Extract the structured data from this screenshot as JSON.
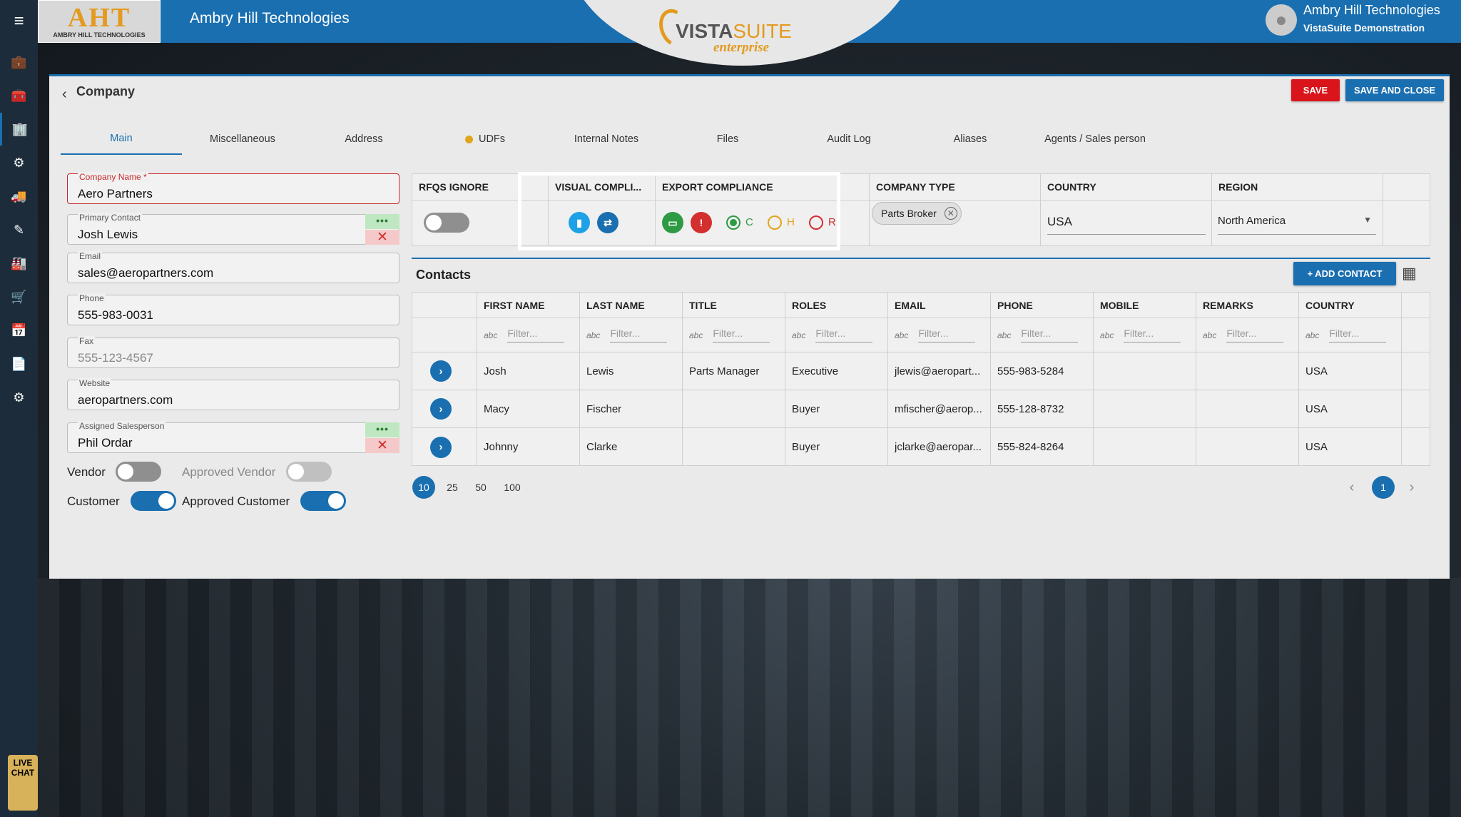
{
  "header": {
    "logo_text": "AHT",
    "logo_subtext": "AMBRY HILL TECHNOLOGIES",
    "app_title": "Ambry Hill Technologies",
    "brand_main": "VISTA",
    "brand_suite": "SUITE",
    "brand_sub": "enterprise",
    "user_name": "Ambry Hill Technologies",
    "user_org": "VistaSuite Demonstration"
  },
  "sidebar": {
    "icons": [
      "menu-icon",
      "briefcase-icon",
      "toolbox-icon",
      "building-icon",
      "parts-icon",
      "truck-icon",
      "edit-icon",
      "warehouse-icon",
      "cart-icon",
      "calendar-icon",
      "document-icon",
      "gear-icon"
    ],
    "live_chat": "LIVE CHAT"
  },
  "page": {
    "title": "Company",
    "save_label": "SAVE",
    "save_close_label": "SAVE AND CLOSE"
  },
  "tabs": [
    "Main",
    "Miscellaneous",
    "Address",
    "UDFs",
    "Internal Notes",
    "Files",
    "Audit Log",
    "Aliases",
    "Agents / Sales person"
  ],
  "form": {
    "company_name_label": "Company Name *",
    "company_name": "Aero Partners",
    "primary_contact_label": "Primary Contact",
    "primary_contact": "Josh Lewis",
    "email_label": "Email",
    "email": "sales@aeropartners.com",
    "phone_label": "Phone",
    "phone": "555-983-0031",
    "fax_label": "Fax",
    "fax": "555-123-4567",
    "website_label": "Website",
    "website": "aeropartners.com",
    "salesperson_label": "Assigned Salesperson",
    "salesperson": "Phil Ordar",
    "vendor_label": "Vendor",
    "approved_vendor_label": "Approved Vendor",
    "customer_label": "Customer",
    "approved_customer_label": "Approved Customer",
    "vendor_on": false,
    "approved_vendor_on": false,
    "customer_on": true,
    "approved_customer_on": true,
    "dots": "•••",
    "x": "✕"
  },
  "compliance": {
    "headers": [
      "RFQS IGNORE",
      "VISUAL COMPLI...",
      "EXPORT COMPLIANCE",
      "COMPANY TYPE",
      "COUNTRY",
      "REGION"
    ],
    "rfqs_ignore_on": false,
    "radio_c": "C",
    "radio_h": "H",
    "radio_r": "R",
    "selected_radio": "C",
    "company_type": "Parts Broker",
    "country": "USA",
    "region": "North America",
    "colors": {
      "green": "#2e9a44",
      "orange": "#e2a41b",
      "red": "#d32f2f",
      "cyan": "#1ea1e6"
    }
  },
  "contacts": {
    "title": "Contacts",
    "add_label": "+ ADD CONTACT",
    "columns": [
      "FIRST NAME",
      "LAST NAME",
      "TITLE",
      "ROLES",
      "EMAIL",
      "PHONE",
      "MOBILE",
      "REMARKS",
      "COUNTRY"
    ],
    "filter_placeholder": "Filter...",
    "rows": [
      [
        "Josh",
        "Lewis",
        "Parts Manager",
        "Executive",
        "jlewis@aeropart...",
        "555-983-5284",
        "",
        "",
        "USA"
      ],
      [
        "Macy",
        "Fischer",
        "",
        "Buyer",
        "mfischer@aerop...",
        "555-128-8732",
        "",
        "",
        "USA"
      ],
      [
        "Johnny",
        "Clarke",
        "",
        "Buyer",
        "jclarke@aeropar...",
        "555-824-8264",
        "",
        "",
        "USA"
      ]
    ],
    "page_sizes": [
      "10",
      "25",
      "50",
      "100"
    ],
    "selected_page_size": "10",
    "current_page": "1"
  }
}
